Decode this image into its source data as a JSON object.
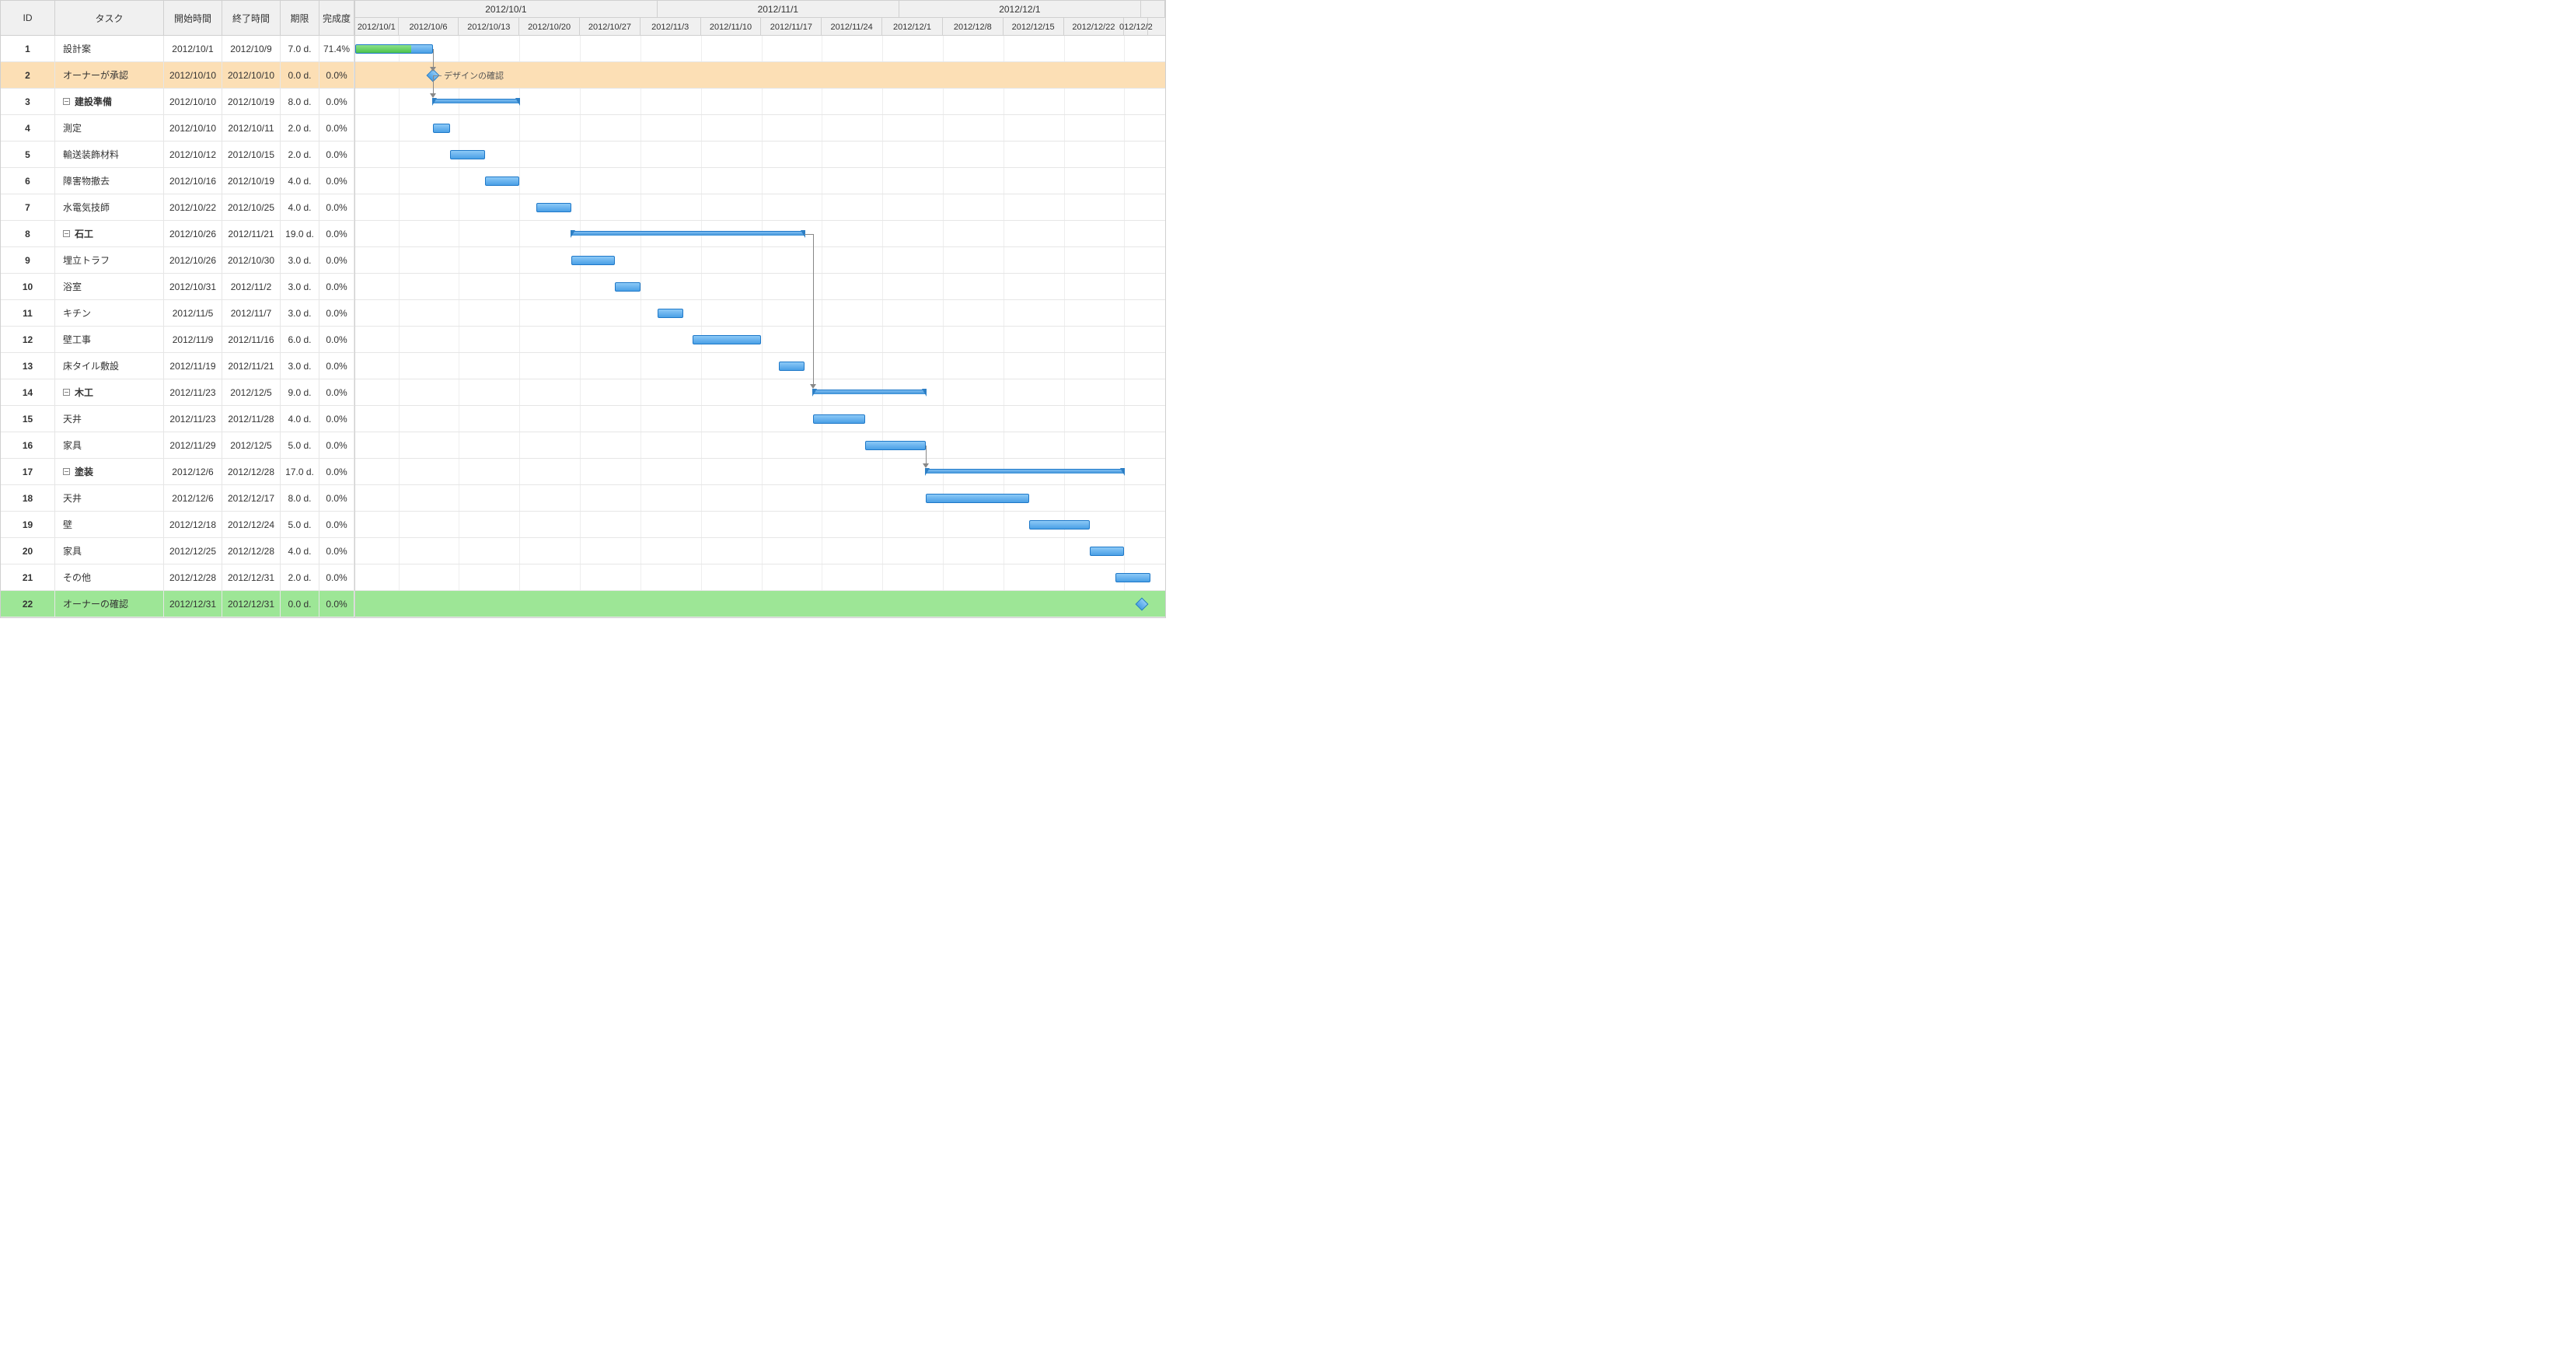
{
  "columns": {
    "id": "ID",
    "task": "タスク",
    "start": "開始時間",
    "end": "終了時間",
    "duration": "期限",
    "completion": "完成度"
  },
  "timeline": {
    "months": [
      {
        "label": "2012/10/1",
        "span": 5
      },
      {
        "label": "2012/11/1",
        "span": 4
      },
      {
        "label": "2012/12/1",
        "span": 4
      },
      {
        "label": "",
        "span": 0.4
      }
    ],
    "weeks": [
      "2012/10/1",
      "2012/10/6",
      "2012/10/13",
      "2012/10/20",
      "2012/10/27",
      "2012/11/3",
      "2012/11/10",
      "2012/11/17",
      "2012/11/24",
      "2012/12/1",
      "2012/12/8",
      "2012/12/15",
      "2012/12/22",
      "012/12/2"
    ]
  },
  "milestone_labels": {
    "2": "デザインの確認"
  },
  "rows": [
    {
      "id": "1",
      "task": "設計案",
      "start": "2012/10/1",
      "end": "2012/10/9",
      "duration": "7.0 d.",
      "pct": "71.4%",
      "indent": 0,
      "type": "task"
    },
    {
      "id": "2",
      "task": "オーナーが承認",
      "start": "2012/10/10",
      "end": "2012/10/10",
      "duration": "0.0 d.",
      "pct": "0.0%",
      "indent": 0,
      "type": "milestone",
      "highlight": "orange"
    },
    {
      "id": "3",
      "task": "建設準備",
      "start": "2012/10/10",
      "end": "2012/10/19",
      "duration": "8.0 d.",
      "pct": "0.0%",
      "indent": 1,
      "type": "summary"
    },
    {
      "id": "4",
      "task": "測定",
      "start": "2012/10/10",
      "end": "2012/10/11",
      "duration": "2.0 d.",
      "pct": "0.0%",
      "indent": 2,
      "type": "task"
    },
    {
      "id": "5",
      "task": "輸送装飾材料",
      "start": "2012/10/12",
      "end": "2012/10/15",
      "duration": "2.0 d.",
      "pct": "0.0%",
      "indent": 2,
      "type": "task"
    },
    {
      "id": "6",
      "task": "障害物撤去",
      "start": "2012/10/16",
      "end": "2012/10/19",
      "duration": "4.0 d.",
      "pct": "0.0%",
      "indent": 2,
      "type": "task"
    },
    {
      "id": "7",
      "task": "水電気技師",
      "start": "2012/10/22",
      "end": "2012/10/25",
      "duration": "4.0 d.",
      "pct": "0.0%",
      "indent": 0,
      "type": "task"
    },
    {
      "id": "8",
      "task": "石工",
      "start": "2012/10/26",
      "end": "2012/11/21",
      "duration": "19.0 d.",
      "pct": "0.0%",
      "indent": 1,
      "type": "summary"
    },
    {
      "id": "9",
      "task": "埋立トラフ",
      "start": "2012/10/26",
      "end": "2012/10/30",
      "duration": "3.0 d.",
      "pct": "0.0%",
      "indent": 2,
      "type": "task"
    },
    {
      "id": "10",
      "task": "浴室",
      "start": "2012/10/31",
      "end": "2012/11/2",
      "duration": "3.0 d.",
      "pct": "0.0%",
      "indent": 2,
      "type": "task"
    },
    {
      "id": "11",
      "task": "キチン",
      "start": "2012/11/5",
      "end": "2012/11/7",
      "duration": "3.0 d.",
      "pct": "0.0%",
      "indent": 2,
      "type": "task"
    },
    {
      "id": "12",
      "task": "壁工事",
      "start": "2012/11/9",
      "end": "2012/11/16",
      "duration": "6.0 d.",
      "pct": "0.0%",
      "indent": 2,
      "type": "task"
    },
    {
      "id": "13",
      "task": "床タイル敷設",
      "start": "2012/11/19",
      "end": "2012/11/21",
      "duration": "3.0 d.",
      "pct": "0.0%",
      "indent": 2,
      "type": "task"
    },
    {
      "id": "14",
      "task": "木工",
      "start": "2012/11/23",
      "end": "2012/12/5",
      "duration": "9.0 d.",
      "pct": "0.0%",
      "indent": 1,
      "type": "summary"
    },
    {
      "id": "15",
      "task": "天井",
      "start": "2012/11/23",
      "end": "2012/11/28",
      "duration": "4.0 d.",
      "pct": "0.0%",
      "indent": 2,
      "type": "task"
    },
    {
      "id": "16",
      "task": "家具",
      "start": "2012/11/29",
      "end": "2012/12/5",
      "duration": "5.0 d.",
      "pct": "0.0%",
      "indent": 2,
      "type": "task"
    },
    {
      "id": "17",
      "task": "塗装",
      "start": "2012/12/6",
      "end": "2012/12/28",
      "duration": "17.0 d.",
      "pct": "0.0%",
      "indent": 1,
      "type": "summary"
    },
    {
      "id": "18",
      "task": "天井",
      "start": "2012/12/6",
      "end": "2012/12/17",
      "duration": "8.0 d.",
      "pct": "0.0%",
      "indent": 2,
      "type": "task"
    },
    {
      "id": "19",
      "task": "壁",
      "start": "2012/12/18",
      "end": "2012/12/24",
      "duration": "5.0 d.",
      "pct": "0.0%",
      "indent": 2,
      "type": "task"
    },
    {
      "id": "20",
      "task": "家具",
      "start": "2012/12/25",
      "end": "2012/12/28",
      "duration": "4.0 d.",
      "pct": "0.0%",
      "indent": 2,
      "type": "task"
    },
    {
      "id": "21",
      "task": "その他",
      "start": "2012/12/28",
      "end": "2012/12/31",
      "duration": "2.0 d.",
      "pct": "0.0%",
      "indent": 0,
      "type": "task"
    },
    {
      "id": "22",
      "task": "オーナーの確認",
      "start": "2012/12/31",
      "end": "2012/12/31",
      "duration": "0.0 d.",
      "pct": "0.0%",
      "indent": 0,
      "type": "milestone",
      "highlight": "green"
    }
  ],
  "chart_data": {
    "type": "gantt",
    "title": "",
    "x_start": "2012/10/1",
    "x_end": "2012/12/31",
    "tasks": [
      {
        "id": 1,
        "name": "設計案",
        "start": "2012-10-01",
        "end": "2012-10-09",
        "type": "task",
        "progress": 71.4
      },
      {
        "id": 2,
        "name": "オーナーが承認",
        "start": "2012-10-10",
        "end": "2012-10-10",
        "type": "milestone",
        "label": "デザインの確認",
        "progress": 0
      },
      {
        "id": 3,
        "name": "建設準備",
        "start": "2012-10-10",
        "end": "2012-10-19",
        "type": "summary",
        "progress": 0
      },
      {
        "id": 4,
        "name": "測定",
        "start": "2012-10-10",
        "end": "2012-10-11",
        "type": "task",
        "progress": 0
      },
      {
        "id": 5,
        "name": "輸送装飾材料",
        "start": "2012-10-12",
        "end": "2012-10-15",
        "type": "task",
        "progress": 0
      },
      {
        "id": 6,
        "name": "障害物撤去",
        "start": "2012-10-16",
        "end": "2012-10-19",
        "type": "task",
        "progress": 0
      },
      {
        "id": 7,
        "name": "水電気技師",
        "start": "2012-10-22",
        "end": "2012-10-25",
        "type": "task",
        "progress": 0
      },
      {
        "id": 8,
        "name": "石工",
        "start": "2012-10-26",
        "end": "2012-11-21",
        "type": "summary",
        "progress": 0
      },
      {
        "id": 9,
        "name": "埋立トラフ",
        "start": "2012-10-26",
        "end": "2012-10-30",
        "type": "task",
        "progress": 0
      },
      {
        "id": 10,
        "name": "浴室",
        "start": "2012-10-31",
        "end": "2012-11-02",
        "type": "task",
        "progress": 0
      },
      {
        "id": 11,
        "name": "キチン",
        "start": "2012-11-05",
        "end": "2012-11-07",
        "type": "task",
        "progress": 0
      },
      {
        "id": 12,
        "name": "壁工事",
        "start": "2012-11-09",
        "end": "2012-11-16",
        "type": "task",
        "progress": 0
      },
      {
        "id": 13,
        "name": "床タイル敷設",
        "start": "2012-11-19",
        "end": "2012-11-21",
        "type": "task",
        "progress": 0
      },
      {
        "id": 14,
        "name": "木工",
        "start": "2012-11-23",
        "end": "2012-12-05",
        "type": "summary",
        "progress": 0
      },
      {
        "id": 15,
        "name": "天井",
        "start": "2012-11-23",
        "end": "2012-11-28",
        "type": "task",
        "progress": 0
      },
      {
        "id": 16,
        "name": "家具",
        "start": "2012-11-29",
        "end": "2012-12-05",
        "type": "task",
        "progress": 0
      },
      {
        "id": 17,
        "name": "塗装",
        "start": "2012-12-06",
        "end": "2012-12-28",
        "type": "summary",
        "progress": 0
      },
      {
        "id": 18,
        "name": "天井",
        "start": "2012-12-06",
        "end": "2012-12-17",
        "type": "task",
        "progress": 0
      },
      {
        "id": 19,
        "name": "壁",
        "start": "2012-12-18",
        "end": "2012-12-24",
        "type": "task",
        "progress": 0
      },
      {
        "id": 20,
        "name": "家具",
        "start": "2012-12-25",
        "end": "2012-12-28",
        "type": "task",
        "progress": 0
      },
      {
        "id": 21,
        "name": "その他",
        "start": "2012-12-28",
        "end": "2012-12-31",
        "type": "task",
        "progress": 0
      },
      {
        "id": 22,
        "name": "オーナーの確認",
        "start": "2012-12-31",
        "end": "2012-12-31",
        "type": "milestone",
        "progress": 0
      }
    ],
    "dependencies": [
      {
        "from": 1,
        "to": 2
      },
      {
        "from": 2,
        "to": 3
      },
      {
        "from": 8,
        "to": 14
      },
      {
        "from": 16,
        "to": 17
      }
    ]
  }
}
